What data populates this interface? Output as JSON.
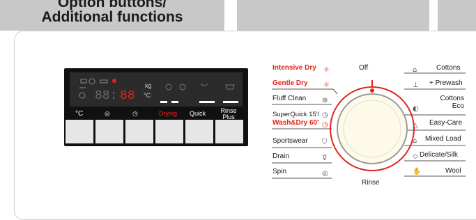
{
  "tabs": [
    {
      "line1": "Option buttons/",
      "line2": "Additional functions"
    },
    {
      "label": ""
    },
    {
      "label": ""
    }
  ],
  "display": {
    "digits": "88:88",
    "unit_kg": "kg",
    "unit_c": "°C",
    "drying_label": "Drying",
    "quick_label": "Quick",
    "rinse_label": "Rinse Plus",
    "btn_labels": [
      "°C",
      "spin-icon",
      "clock-icon"
    ]
  },
  "dial": {
    "top_label": "Off",
    "bottom_label": "Rinse",
    "left": [
      {
        "label": "Intensive Dry",
        "red": true
      },
      {
        "label": "Gentle Dry",
        "red": true
      },
      {
        "label": "Fluff Clean",
        "red": false
      },
      {
        "label": "SuperQuick 15'/",
        "red": false
      },
      {
        "label": "Wash&Dry 60'",
        "red": true
      },
      {
        "label": "Sportswear",
        "red": false
      },
      {
        "label": "Drain",
        "red": false
      },
      {
        "label": "Spin",
        "red": false
      }
    ],
    "right": [
      {
        "label": "Cottons"
      },
      {
        "label": "+ Prewash"
      },
      {
        "label": "Cottons Eco"
      },
      {
        "label": "Easy-Care"
      },
      {
        "label": "Mixed Load"
      },
      {
        "label": "Delicate/Silk"
      },
      {
        "label": "Wool"
      }
    ]
  },
  "colors": {
    "accent": "#e2231a",
    "display_bg": "#111111",
    "tab_bg": "#c8c8c8"
  }
}
